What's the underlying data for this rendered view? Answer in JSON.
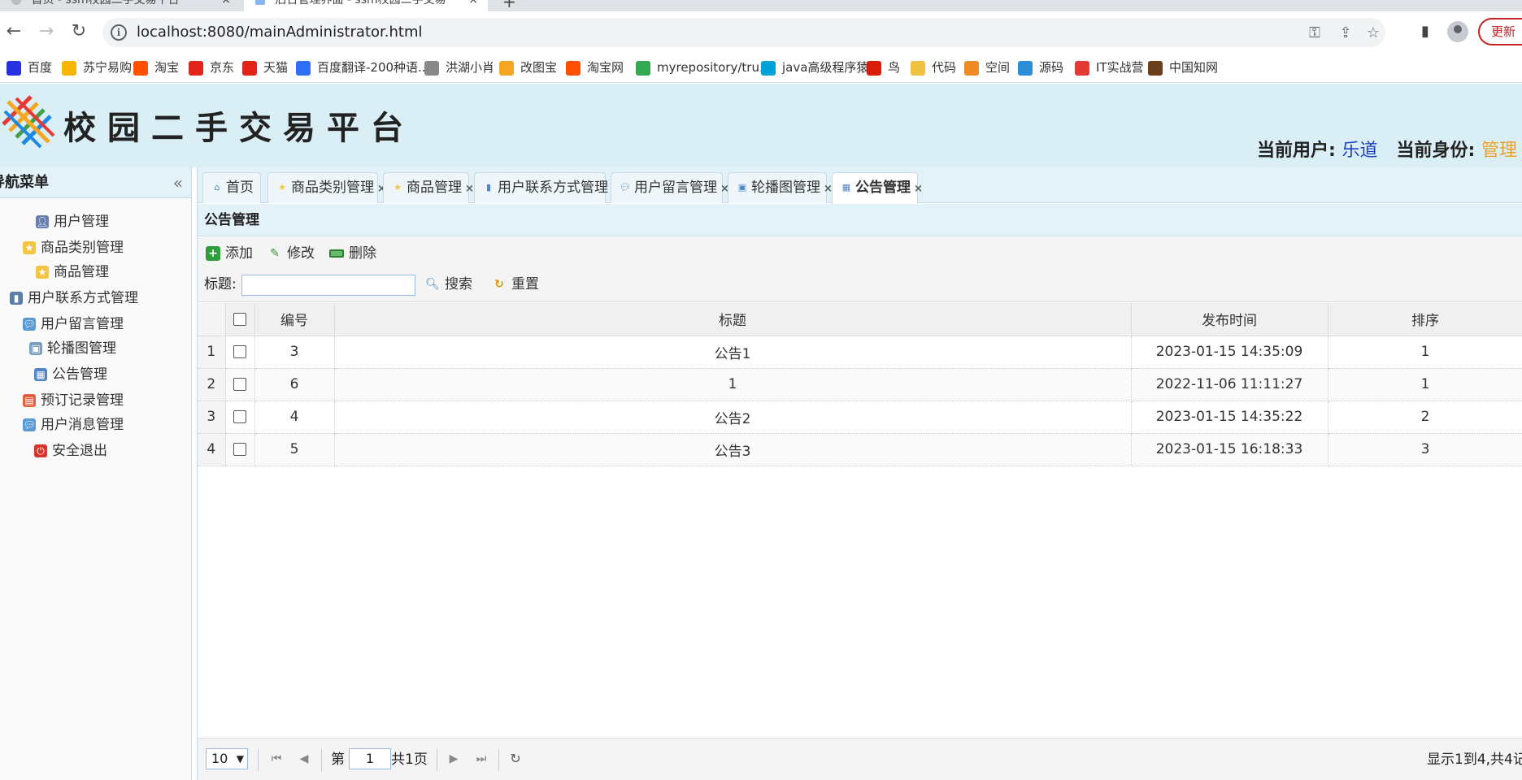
{
  "browser": {
    "tabs": [
      {
        "label": "首页 - ssm校园二手交易平台",
        "active": false
      },
      {
        "label": "后台管理界面 - ssm校园二手交易",
        "active": true
      }
    ],
    "url": "localhost:8080/mainAdministrator.html",
    "update_label": "更新",
    "bookmarks": [
      {
        "label": "百度",
        "color": "#2932e1"
      },
      {
        "label": "苏宁易购",
        "color": "#f7b500"
      },
      {
        "label": "淘宝",
        "color": "#ff5000"
      },
      {
        "label": "京东",
        "color": "#e1251b"
      },
      {
        "label": "天猫",
        "color": "#e1251b"
      },
      {
        "label": "百度翻译-200种语...",
        "color": "#2f6ef7"
      },
      {
        "label": "洪湖小肖",
        "color": "#888888"
      },
      {
        "label": "改图宝",
        "color": "#f5a623"
      },
      {
        "label": "淘宝网",
        "color": "#ff5000"
      },
      {
        "label": "myrepository/tru...",
        "color": "#34a853"
      },
      {
        "label": "java高级程序猿",
        "color": "#00a1d6"
      },
      {
        "label": "鸟",
        "color": "#d81e06"
      },
      {
        "label": "代码",
        "color": "#f0c040"
      },
      {
        "label": "空间",
        "color": "#f08a24"
      },
      {
        "label": "源码",
        "color": "#2a8fd8"
      },
      {
        "label": "IT实战营",
        "color": "#e53935"
      },
      {
        "label": "中国知网",
        "color": "#6b3e1c"
      }
    ]
  },
  "header": {
    "app_title": "校园二手交易平台",
    "current_user_label": "当前用户:",
    "current_user": "乐道",
    "current_role_label": "当前身份:",
    "current_role": "管理"
  },
  "leftnav": {
    "title": "导航菜单",
    "collapse_icon": "«",
    "items": [
      {
        "label": "用户管理",
        "icon": "user-icon",
        "color": "#6a7fb0"
      },
      {
        "label": "商品类别管理",
        "icon": "star-icon",
        "color": "#f5c542"
      },
      {
        "label": "商品管理",
        "icon": "star-icon",
        "color": "#f5c542"
      },
      {
        "label": "用户联系方式管理",
        "icon": "phone-icon",
        "color": "#5a7fa8"
      },
      {
        "label": "用户留言管理",
        "icon": "comment-icon",
        "color": "#5b9bd5"
      },
      {
        "label": "轮播图管理",
        "icon": "images-icon",
        "color": "#7a9fc0"
      },
      {
        "label": "公告管理",
        "icon": "table-icon",
        "color": "#4f86c6"
      },
      {
        "label": "预订记录管理",
        "icon": "calendar-icon",
        "color": "#e06040"
      },
      {
        "label": "用户消息管理",
        "icon": "message-icon",
        "color": "#5b9bd5"
      },
      {
        "label": "安全退出",
        "icon": "power-icon",
        "color": "#d9342b"
      }
    ]
  },
  "main": {
    "tabs": [
      {
        "label": "首页",
        "icon": "home-icon",
        "closable": false,
        "active": false
      },
      {
        "label": "商品类别管理",
        "icon": "star-icon",
        "closable": true,
        "active": false
      },
      {
        "label": "商品管理",
        "icon": "star-icon",
        "closable": true,
        "active": false
      },
      {
        "label": "用户联系方式管理",
        "icon": "phone-icon",
        "closable": true,
        "active": false
      },
      {
        "label": "用户留言管理",
        "icon": "comment-icon",
        "closable": true,
        "active": false
      },
      {
        "label": "轮播图管理",
        "icon": "images-icon",
        "closable": true,
        "active": false
      },
      {
        "label": "公告管理",
        "icon": "table-icon",
        "closable": true,
        "active": true
      }
    ],
    "tab_close_glyph": "×",
    "panel_title": "公告管理",
    "toolbar": {
      "add_label": "添加",
      "edit_label": "修改",
      "delete_label": "删除",
      "search_label": "标题:",
      "search_value": "",
      "search_button": "搜索",
      "reset_button": "重置"
    },
    "grid": {
      "columns": [
        "编号",
        "标题",
        "发布时间",
        "排序"
      ],
      "rows": [
        {
          "rownum": "1",
          "id": "3",
          "title": "公告1",
          "time": "2023-01-15 14:35:09",
          "order": "1"
        },
        {
          "rownum": "2",
          "id": "6",
          "title": "1",
          "time": "2022-11-06 11:11:27",
          "order": "1"
        },
        {
          "rownum": "3",
          "id": "4",
          "title": "公告2",
          "time": "2023-01-15 14:35:22",
          "order": "2"
        },
        {
          "rownum": "4",
          "id": "5",
          "title": "公告3",
          "time": "2023-01-15 16:18:33",
          "order": "3"
        }
      ]
    },
    "pager": {
      "page_size": "10",
      "page_prefix": "第",
      "page_value": "1",
      "page_suffix": "共1页",
      "info": "显示1到4,共4记"
    }
  }
}
